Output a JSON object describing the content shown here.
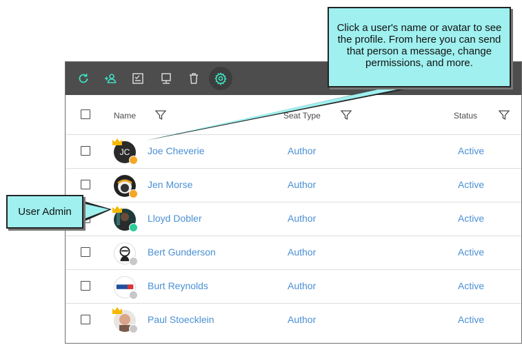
{
  "toolbar": {
    "buttons": [
      {
        "icon": "refresh-icon"
      },
      {
        "icon": "add-user-icon"
      },
      {
        "icon": "checklist-icon"
      },
      {
        "icon": "monitor-icon"
      },
      {
        "icon": "trash-icon"
      },
      {
        "icon": "gear-icon",
        "active": true
      }
    ],
    "accent_color": "#3fe0c0",
    "background": "#4d4d4d"
  },
  "table": {
    "headers": {
      "name": "Name",
      "seat_type": "Seat Type",
      "status": "Status"
    },
    "rows": [
      {
        "name": "Joe Cheverie",
        "initials": "JC",
        "seat_type": "Author",
        "status": "Active",
        "admin": true,
        "presence": "away"
      },
      {
        "name": "Jen Morse",
        "initials": "",
        "seat_type": "Author",
        "status": "Active",
        "admin": false,
        "presence": "away"
      },
      {
        "name": "Lloyd Dobler",
        "initials": "",
        "seat_type": "Author",
        "status": "Active",
        "admin": true,
        "presence": "online"
      },
      {
        "name": "Bert Gunderson",
        "initials": "",
        "seat_type": "Author",
        "status": "Active",
        "admin": false,
        "presence": "offline"
      },
      {
        "name": "Burt Reynolds",
        "initials": "",
        "seat_type": "Author",
        "status": "Active",
        "admin": false,
        "presence": "offline"
      },
      {
        "name": "Paul Stoecklein",
        "initials": "",
        "seat_type": "Author",
        "status": "Active",
        "admin": true,
        "presence": "offline"
      }
    ],
    "link_color": "#4a8fd4",
    "presence_colors": {
      "away": "#f5a623",
      "online": "#2ecc9a",
      "offline": "#c8c8c8"
    }
  },
  "callouts": {
    "profile": "Click a user's name or avatar to see the profile. From here you can send that person a message, change permissions, and more.",
    "admin": "User Admin",
    "fill_color": "#9ff0ef"
  }
}
